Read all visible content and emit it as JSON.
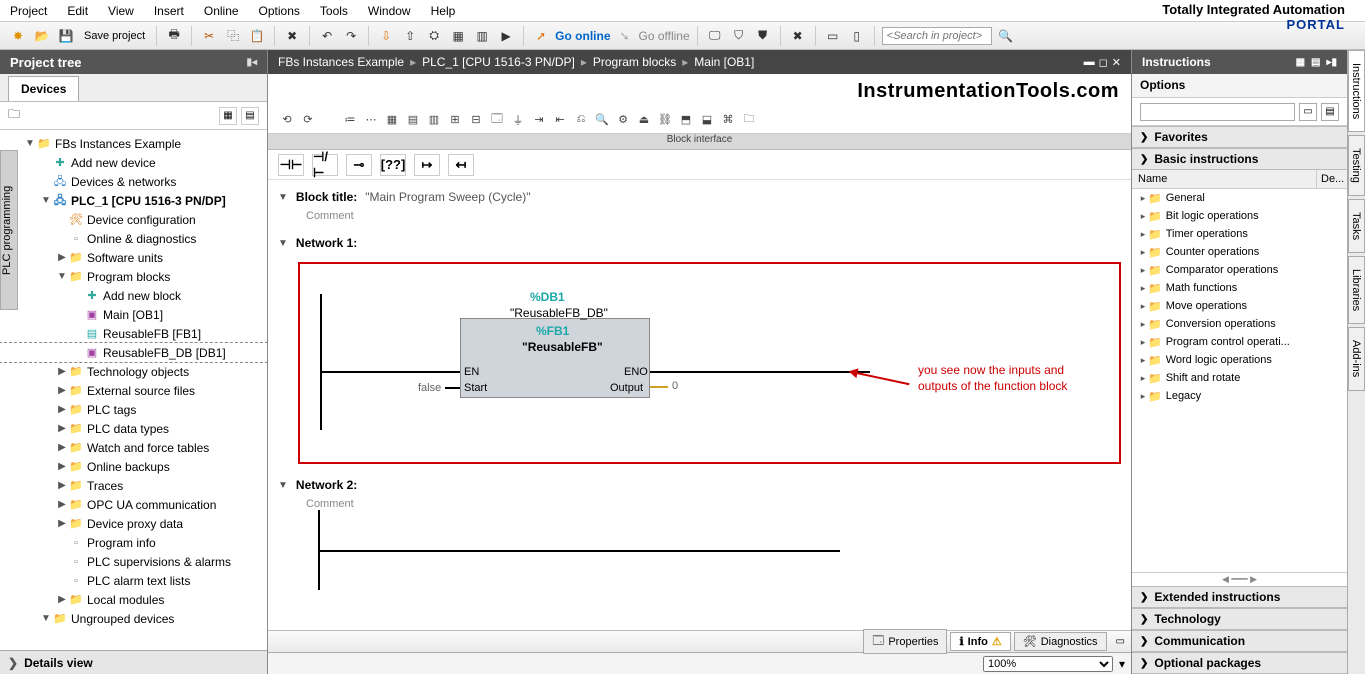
{
  "menus": [
    "Project",
    "Edit",
    "View",
    "Insert",
    "Online",
    "Options",
    "Tools",
    "Window",
    "Help"
  ],
  "brand": {
    "line1": "Totally Integrated Automation",
    "line2": "PORTAL"
  },
  "toolbar": {
    "saveLabel": "Save project",
    "goOnline": "Go online",
    "goOffline": "Go offline",
    "searchPlaceholder": "<Search in project>"
  },
  "leftPane": {
    "title": "Project tree",
    "tab": "Devices",
    "sideTab": "PLC programming",
    "details": "Details view"
  },
  "tree": [
    {
      "indent": 0,
      "exp": "▼",
      "icon": "folder",
      "label": "FBs Instances Example",
      "bold": false
    },
    {
      "indent": 1,
      "exp": "",
      "icon": "add",
      "label": "Add new device"
    },
    {
      "indent": 1,
      "exp": "",
      "icon": "net",
      "label": "Devices & networks"
    },
    {
      "indent": 1,
      "exp": "▼",
      "icon": "net",
      "label": "PLC_1 [CPU 1516-3 PN/DP]",
      "bold": true
    },
    {
      "indent": 2,
      "exp": "",
      "icon": "cfg",
      "label": "Device configuration"
    },
    {
      "indent": 2,
      "exp": "",
      "icon": "gen",
      "label": "Online & diagnostics"
    },
    {
      "indent": 2,
      "exp": "▶",
      "icon": "folder",
      "label": "Software units"
    },
    {
      "indent": 2,
      "exp": "▼",
      "icon": "folder",
      "label": "Program blocks"
    },
    {
      "indent": 3,
      "exp": "",
      "icon": "add",
      "label": "Add new block"
    },
    {
      "indent": 3,
      "exp": "",
      "icon": "db",
      "label": "Main [OB1]"
    },
    {
      "indent": 3,
      "exp": "",
      "icon": "fb",
      "label": "ReusableFB [FB1]"
    },
    {
      "indent": 3,
      "exp": "",
      "icon": "db",
      "label": "ReusableFB_DB [DB1]",
      "selected": true
    },
    {
      "indent": 2,
      "exp": "▶",
      "icon": "folder",
      "label": "Technology objects"
    },
    {
      "indent": 2,
      "exp": "▶",
      "icon": "folder",
      "label": "External source files"
    },
    {
      "indent": 2,
      "exp": "▶",
      "icon": "folder",
      "label": "PLC tags"
    },
    {
      "indent": 2,
      "exp": "▶",
      "icon": "folder",
      "label": "PLC data types"
    },
    {
      "indent": 2,
      "exp": "▶",
      "icon": "folder",
      "label": "Watch and force tables"
    },
    {
      "indent": 2,
      "exp": "▶",
      "icon": "folder",
      "label": "Online backups"
    },
    {
      "indent": 2,
      "exp": "▶",
      "icon": "folder",
      "label": "Traces"
    },
    {
      "indent": 2,
      "exp": "▶",
      "icon": "folder",
      "label": "OPC UA communication"
    },
    {
      "indent": 2,
      "exp": "▶",
      "icon": "folder",
      "label": "Device proxy data"
    },
    {
      "indent": 2,
      "exp": "",
      "icon": "gen",
      "label": "Program info"
    },
    {
      "indent": 2,
      "exp": "",
      "icon": "gen",
      "label": "PLC supervisions & alarms"
    },
    {
      "indent": 2,
      "exp": "",
      "icon": "gen",
      "label": "PLC alarm text lists"
    },
    {
      "indent": 2,
      "exp": "▶",
      "icon": "folder",
      "label": "Local modules"
    },
    {
      "indent": 1,
      "exp": "▼",
      "icon": "folder",
      "label": "Ungrouped devices"
    }
  ],
  "breadcrumb": [
    "FBs Instances Example",
    "PLC_1 [CPU 1516-3 PN/DP]",
    "Program blocks",
    "Main [OB1]"
  ],
  "watermark": "InstrumentationTools.com",
  "blockInterfaceLabel": "Block interface",
  "blockTitle": {
    "label": "Block title:",
    "value": "\"Main Program Sweep (Cycle)\""
  },
  "comment": "Comment",
  "net1": {
    "title": "Network 1:"
  },
  "fb": {
    "db": "%DB1",
    "dbName": "\"ReusableFB_DB\"",
    "id": "%FB1",
    "name": "\"ReusableFB\"",
    "en": "EN",
    "eno": "ENO",
    "start": "Start",
    "output": "Output",
    "falseVal": "false",
    "zeroVal": "0"
  },
  "annotation": "you see now the inputs and outputs of the function block",
  "net2": {
    "title": "Network 2:"
  },
  "zoom": "100%",
  "statusTabs": {
    "properties": "Properties",
    "info": "Info",
    "diagnostics": "Diagnostics"
  },
  "rightPane": {
    "title": "Instructions",
    "options": "Options",
    "sections": {
      "favorites": "Favorites",
      "basic": "Basic instructions",
      "extended": "Extended instructions",
      "technology": "Technology",
      "communication": "Communication",
      "optional": "Optional packages"
    },
    "headerName": "Name",
    "headerDesc": "De...",
    "sideTabs": [
      "Instructions",
      "Testing",
      "Tasks",
      "Libraries",
      "Add-ins"
    ]
  },
  "instructions": [
    "General",
    "Bit logic operations",
    "Timer operations",
    "Counter operations",
    "Comparator operations",
    "Math functions",
    "Move operations",
    "Conversion operations",
    "Program control operati...",
    "Word logic operations",
    "Shift and rotate",
    "Legacy"
  ]
}
